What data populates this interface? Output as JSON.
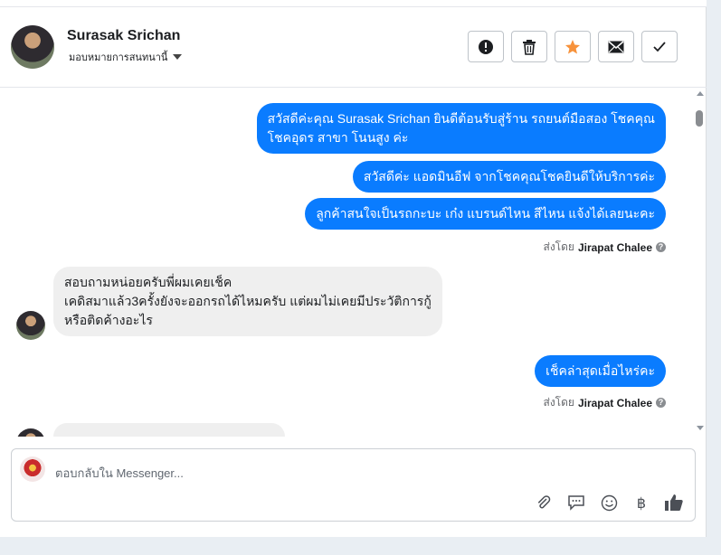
{
  "header": {
    "name": "Surasak Srichan",
    "assign_label": "มอบหมายการสนทนานี้"
  },
  "actions": [
    {
      "icon": "alert-icon"
    },
    {
      "icon": "trash-icon"
    },
    {
      "icon": "star-icon",
      "color": "#f7923b"
    },
    {
      "icon": "mail-icon"
    },
    {
      "icon": "check-icon"
    }
  ],
  "messages": {
    "out1_line1": "สวัสดีค่ะคุณ Surasak Srichan ยินดีต้อนรับสู่ร้าน รถยนต์มือสอง โชคคุณ",
    "out1_line2": "โชคอุดร สาขา โนนสูง ค่ะ",
    "out2": "สวัสดีค่ะ แอดมินอีฟ จากโชคคุณโชคยินดีให้บริการค่ะ",
    "out3": "ลูกค้าสนใจเป็นรถกะบะ เก๋ง แบรนด์ไหน สีไหน แจ้งได้เลยนะคะ",
    "sent_by_label": "ส่งโดย",
    "sent_by_name": "Jirapat Chalee",
    "in1_line1": "สอบถามหน่อยครับพี่ผมเคยเช็ค",
    "in1_line2": "เคดิสมาแล้ว3ครั้งยังจะออกรถได้ไหมครับ แต่ผมไม่เคยมีประวัติการกู้",
    "in1_line3": "หรือติดค้างอะไร",
    "out4": "เช็คล่าสุดเมื่อไหร่คะ",
    "sent_by_label2": "ส่งโดย",
    "sent_by_name2": "Jirapat Chalee"
  },
  "reply": {
    "placeholder": "ตอบกลับใน Messenger..."
  },
  "colors": {
    "accent": "#0a7cff",
    "incoming": "#efefef"
  }
}
